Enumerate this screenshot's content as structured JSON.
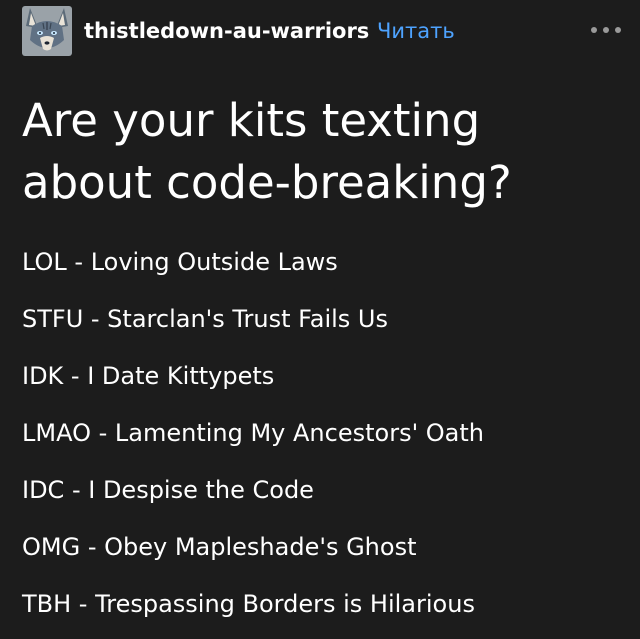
{
  "post": {
    "blog_name": "thistledown-au-warriors",
    "follow_label": "Читать",
    "title": "Are your kits texting about code-breaking?",
    "items": [
      "LOL - Loving Outside Laws",
      "STFU - Starclan's Trust Fails Us",
      "IDK - I Date Kittypets",
      "LMAO - Lamenting My Ancestors' Oath",
      "IDC - I Despise the Code",
      "OMG - Obey Mapleshade's Ghost",
      "TBH - Trespassing Borders is Hilarious"
    ]
  },
  "icons": {
    "avatar": "wolf-avatar-icon",
    "more": "ellipsis-menu-icon"
  },
  "colors": {
    "background": "#1c1c1c",
    "text": "#ffffff",
    "accent": "#4ea3ff",
    "muted": "#9a9a9a"
  }
}
